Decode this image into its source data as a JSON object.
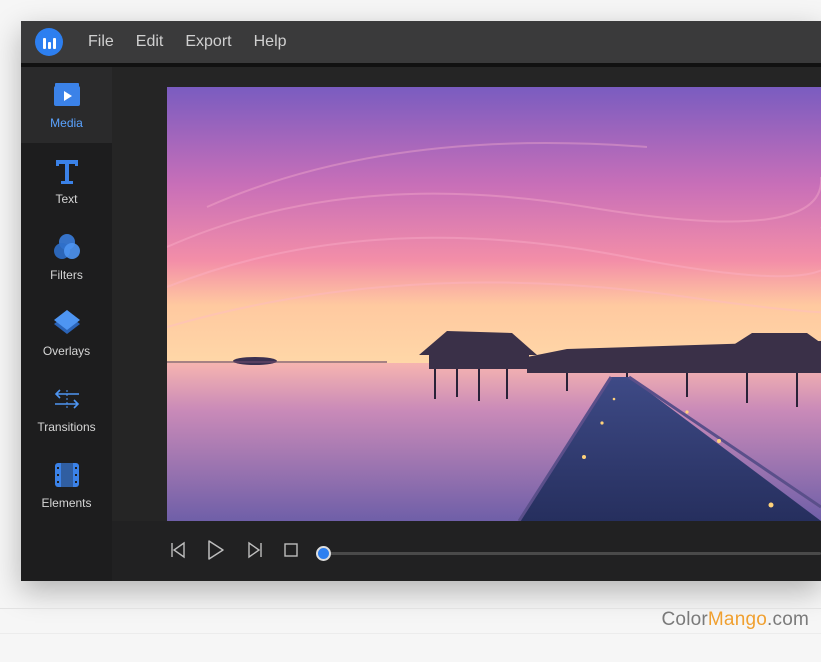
{
  "menubar": {
    "items": [
      "File",
      "Edit",
      "Export",
      "Help"
    ]
  },
  "sidebar": {
    "items": [
      {
        "label": "Media",
        "icon": "media-icon",
        "active": true
      },
      {
        "label": "Text",
        "icon": "text-icon",
        "active": false
      },
      {
        "label": "Filters",
        "icon": "filters-icon",
        "active": false
      },
      {
        "label": "Overlays",
        "icon": "overlays-icon",
        "active": false
      },
      {
        "label": "Transitions",
        "icon": "transitions-icon",
        "active": false
      },
      {
        "label": "Elements",
        "icon": "elements-icon",
        "active": false
      }
    ]
  },
  "playback": {
    "controls": [
      "step-back-icon",
      "play-icon",
      "step-forward-icon",
      "stop-icon"
    ],
    "progress": 0
  },
  "colors": {
    "accent": "#2d7ff0",
    "active_label": "#5aa3ff",
    "watermark_highlight": "#f0a030"
  },
  "watermark": {
    "part1": "Color",
    "part2": "Mango",
    "part3": ".com"
  }
}
